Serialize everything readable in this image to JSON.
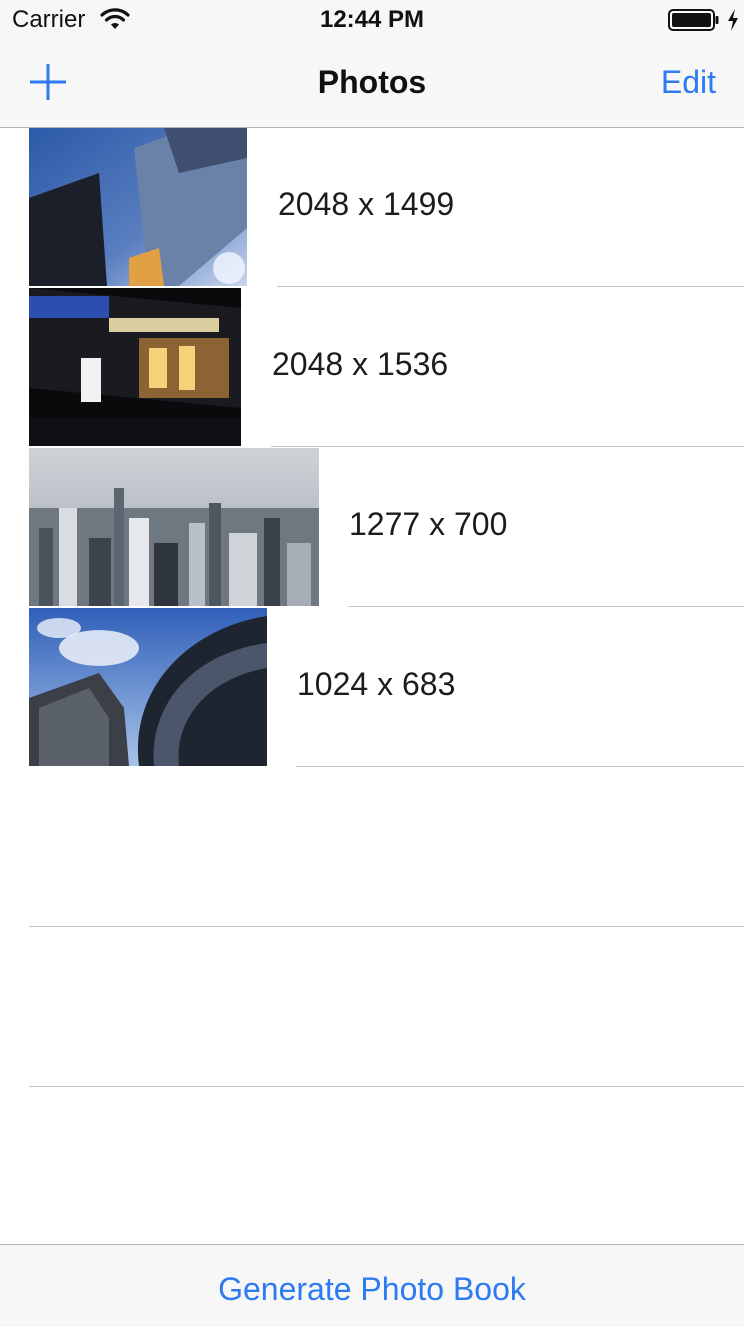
{
  "status_bar": {
    "carrier": "Carrier",
    "time": "12:44 PM",
    "wifi_icon": "wifi-icon",
    "battery_icon": "battery-icon",
    "charging_icon": "charging-bolt-icon"
  },
  "nav_bar": {
    "title": "Photos",
    "add_icon": "plus-icon",
    "edit_label": "Edit"
  },
  "rows": [
    {
      "label": "2048 x 1499",
      "thumbnail": "skyscrapers-looking-up-photo"
    },
    {
      "label": "2048 x 1536",
      "thumbnail": "night-street-neon-photo"
    },
    {
      "label": "1277 x 700",
      "thumbnail": "city-skyline-photo"
    },
    {
      "label": "1024 x 683",
      "thumbnail": "curved-glass-towers-photo"
    }
  ],
  "toolbar": {
    "generate_label": "Generate Photo Book"
  },
  "colors": {
    "accent": "#2d7bf0",
    "bar_background": "#f7f7f7",
    "separator": "#c8c8cc"
  }
}
